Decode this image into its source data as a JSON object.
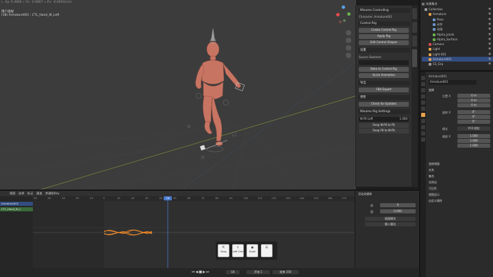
{
  "viewport": {
    "info_line1": "ı.. Xy: 0.4846 » Yz: -0.9867 » Zx: -0.0003(cm)",
    "info_line2": "(18) Armature001 : CTL_Hand_IK_Left",
    "mode_label": "用户透视"
  },
  "npanel": {
    "title": "Mixamo Controlling",
    "object_label": "Character: Armature001",
    "control_rig_head": "Control Rig",
    "btn_create": "Create Control Rig",
    "btn_apply": "Apply Rig",
    "btn_edit": "Edit Control Shapes",
    "section_settings": "设置",
    "source_label": "Source Skeleton:",
    "btn_bake": "Bake to Control Rig",
    "btn_quick": "Quick Animation",
    "section_export": "导出",
    "btn_fbx": "FBX Export",
    "section_update": "更新",
    "btn_update": "Check for Updates",
    "section_rigsettings": "Mixamo Rig Settings",
    "ikfk_label": "IK-FK Left",
    "ikfk_value": "1.000",
    "btn_snap1": "Snap IK-FK to FK",
    "btn_snap2": "Snap FK to IK-FK",
    "tabs": [
      "视图",
      "工具",
      "项目",
      "Mixamo"
    ]
  },
  "outliner": {
    "search_label": "场景集合",
    "rows": [
      {
        "label": "Collection",
        "indent": 0,
        "color": "#9a9a9a",
        "sel": false
      },
      {
        "label": "Armature",
        "indent": 1,
        "color": "#e6a24c",
        "sel": false
      },
      {
        "label": "Pose",
        "indent": 2,
        "color": "#6b94c9",
        "sel": false
      },
      {
        "label": "动作",
        "indent": 2,
        "color": "#6b94c9",
        "sel": false
      },
      {
        "label": "动画",
        "indent": 2,
        "color": "#6b94c9",
        "sel": false
      },
      {
        "label": "Alpha_Joints",
        "indent": 2,
        "color": "#6ab04c",
        "sel": false
      },
      {
        "label": "Alpha_Surface",
        "indent": 2,
        "color": "#6ab04c",
        "sel": false
      },
      {
        "label": "Camera",
        "indent": 1,
        "color": "#d94c4c",
        "sel": false
      },
      {
        "label": "Light",
        "indent": 1,
        "color": "#e6a24c",
        "sel": false
      },
      {
        "label": "Light.001",
        "indent": 1,
        "color": "#e6a24c",
        "sel": false
      },
      {
        "label": "Armature001",
        "indent": 1,
        "color": "#e6a24c",
        "sel": true
      },
      {
        "label": "CS_Grp",
        "indent": 1,
        "color": "#9a9a9a",
        "sel": false
      }
    ]
  },
  "properties": {
    "object_name": "Armature001",
    "data_name": "Armature001",
    "transform_head": "变换",
    "loc_label": "位置 X",
    "loc": [
      "0 m",
      "0 m",
      "0 m"
    ],
    "rot_label": "旋转 X",
    "rot": [
      "0°",
      "0°",
      "0°"
    ],
    "mode_label": "模式",
    "mode_value": "XYZ 欧拉",
    "scale_label": "缩放 X",
    "scale": [
      "1.000",
      "1.000",
      "1.000"
    ],
    "sections": [
      "变换增量",
      "关系",
      "集合",
      "实例化",
      "可见性",
      "视图显示",
      "自定义属性"
    ]
  },
  "timeline": {
    "menus": [
      "视图",
      "选择",
      "标记",
      "通道",
      "关键帧",
      "Key"
    ],
    "channels": [
      "Armature001",
      "CTL_Hand_IK_L"
    ],
    "frames": [
      "-50",
      "-40",
      "-30",
      "-20",
      "-10",
      "0",
      "10",
      "20",
      "30",
      "40",
      "50",
      "60",
      "70",
      "80",
      "90",
      "100",
      "110",
      "120",
      "130",
      "140",
      "150",
      "160",
      "170"
    ],
    "current_frame": "18",
    "side_head": "活动关键帧",
    "side_frame_label": "帧",
    "side_frame": "0",
    "side_value_label": "值",
    "side_value": "0.000",
    "side_interp": "插值模式",
    "side_easing": "缓入缓出",
    "footer_frame": "18",
    "footer_start": "开始 1",
    "footer_end": "结束 250"
  },
  "keys": [
    {
      "icon": "⇱",
      "label": "Drag"
    },
    {
      "icon": "⇧",
      "label": "Left Click"
    },
    {
      "icon": "◉",
      "label": "Scroll"
    },
    {
      "icon": "G",
      "label": ""
    }
  ],
  "colors": {
    "character": "#c87462",
    "selection": "#334d80",
    "curve": "#e8862a",
    "playhead": "#4a7acc"
  }
}
